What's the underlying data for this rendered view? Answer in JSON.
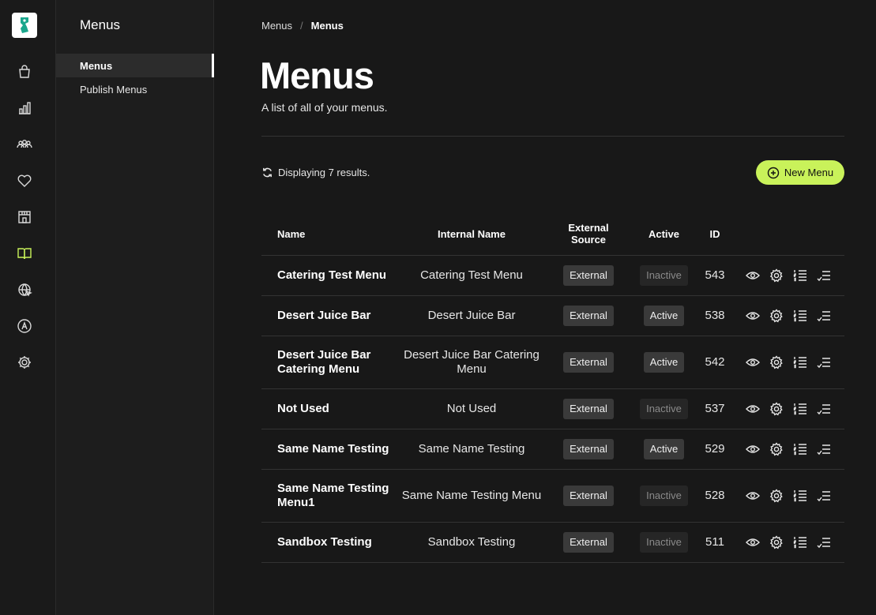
{
  "rail": {
    "items": [
      {
        "icon": "shopping-bag-icon",
        "active": false
      },
      {
        "icon": "bar-chart-icon",
        "active": false
      },
      {
        "icon": "users-icon",
        "active": false
      },
      {
        "icon": "heart-icon",
        "active": false
      },
      {
        "icon": "storefront-icon",
        "active": false
      },
      {
        "icon": "open-book-icon",
        "active": true
      },
      {
        "icon": "globe-cursor-icon",
        "active": false
      },
      {
        "icon": "app-a-icon",
        "active": false
      },
      {
        "icon": "gear-icon",
        "active": false
      }
    ],
    "accent": "#c9f25a"
  },
  "subnav": {
    "title": "Menus",
    "items": [
      {
        "label": "Menus",
        "active": true
      },
      {
        "label": "Publish Menus",
        "active": false
      }
    ]
  },
  "breadcrumb": {
    "items": [
      "Menus",
      "Menus"
    ],
    "separator": "/"
  },
  "page": {
    "title": "Menus",
    "subtitle": "A list of all of your menus.",
    "results_text": "Displaying 7 results.",
    "new_button_label": "New Menu"
  },
  "table": {
    "headers": {
      "name": "Name",
      "internal_name": "Internal Name",
      "external_source": "External Source",
      "active": "Active",
      "id": "ID"
    },
    "rows": [
      {
        "name": "Catering Test Menu",
        "internal_name": "Catering Test Menu",
        "source": "External",
        "status": "Inactive",
        "id": "543"
      },
      {
        "name": "Desert Juice Bar",
        "internal_name": "Desert Juice Bar",
        "source": "External",
        "status": "Active",
        "id": "538"
      },
      {
        "name": "Desert Juice Bar Catering Menu",
        "internal_name": "Desert Juice Bar Catering Menu",
        "source": "External",
        "status": "Active",
        "id": "542"
      },
      {
        "name": "Not Used",
        "internal_name": "Not Used",
        "source": "External",
        "status": "Inactive",
        "id": "537"
      },
      {
        "name": "Same Name Testing",
        "internal_name": "Same Name Testing",
        "source": "External",
        "status": "Active",
        "id": "529"
      },
      {
        "name": "Same Name Testing Menu1",
        "internal_name": "Same Name Testing Menu",
        "source": "External",
        "status": "Inactive",
        "id": "528"
      },
      {
        "name": "Sandbox Testing",
        "internal_name": "Sandbox Testing",
        "source": "External",
        "status": "Inactive",
        "id": "511"
      }
    ],
    "row_actions": [
      "eye-icon",
      "gear-icon",
      "numbered-list-icon",
      "checklist-icon"
    ]
  }
}
